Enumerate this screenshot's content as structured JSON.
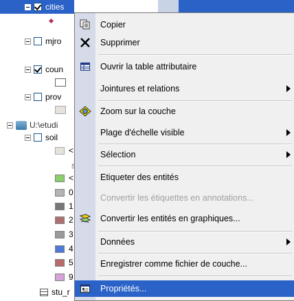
{
  "toc": {
    "layers": [
      {
        "name": "cities",
        "checked": true,
        "selected": true
      },
      {
        "name": "mjro",
        "checked": false
      },
      {
        "name": "coun",
        "checked": true
      },
      {
        "name": "prov",
        "checked": false
      },
      {
        "name": "U:\\etudi",
        "group": true
      },
      {
        "name": "soil",
        "checked": false
      },
      {
        "name": "stu_r"
      }
    ],
    "legend_labels": [
      "<",
      "s",
      "<",
      "0",
      "1",
      "2",
      "3",
      "4",
      "5",
      "9"
    ],
    "legend_colors": [
      "#e6e3dd",
      "#8cd06e",
      "#b4b4b4",
      "#777777",
      "#b07070",
      "#9a9a9a",
      "#4f79d8",
      "#b96a6a",
      "#d6a3d6"
    ],
    "accent": "#2a62c7"
  },
  "menu": {
    "items": [
      {
        "label": "Copier",
        "icon": "copy-icon"
      },
      {
        "label": "Supprimer",
        "icon": "delete-x-icon"
      },
      {
        "label": "Ouvrir la table attributaire",
        "icon": "table-icon"
      },
      {
        "label": "Jointures et relations",
        "submenu": true
      },
      {
        "label": "Zoom sur la couche",
        "icon": "zoom-layer-icon"
      },
      {
        "label": "Plage d'échelle visible",
        "submenu": true
      },
      {
        "label": "Sélection",
        "submenu": true
      },
      {
        "label": "Etiqueter des entités"
      },
      {
        "label": "Convertir les étiquettes en annotations...",
        "disabled": true
      },
      {
        "label": "Convertir les entités en graphiques...",
        "icon": "convert-graphics-icon"
      },
      {
        "label": "Données",
        "submenu": true
      },
      {
        "label": "Enregistrer comme fichier de couche..."
      },
      {
        "label": "Propriétés...",
        "icon": "properties-icon",
        "selected": true
      }
    ]
  }
}
